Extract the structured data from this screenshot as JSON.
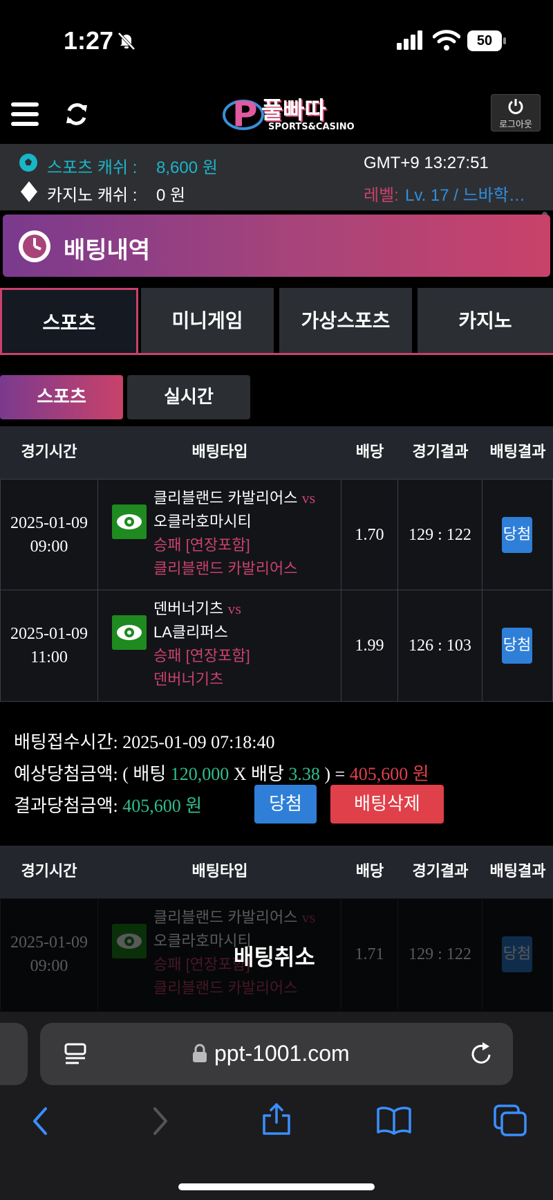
{
  "status": {
    "time": "1:27",
    "battery": "50"
  },
  "header": {
    "logo_text": "풀빠따",
    "logo_sub": "SPORTS&CASINO",
    "logout_label": "로그아웃"
  },
  "info": {
    "sports_cash_label": "스포츠 캐쉬 :",
    "sports_cash_value": "8,600 원",
    "casino_cash_label": "카지노 캐쉬 :",
    "casino_cash_value": "0 원",
    "clock": "GMT+9 13:27:51",
    "level_label": "레벨:",
    "level_value": "Lv. 17 / 느바학…"
  },
  "banner": {
    "title": "배팅내역"
  },
  "tabs": [
    "스포츠",
    "미니게임",
    "가상스포츠",
    "카지노"
  ],
  "subtabs": [
    "스포츠",
    "실시간"
  ],
  "table_headers": [
    "경기시간",
    "배팅타입",
    "배당",
    "경기결과",
    "배팅결과"
  ],
  "bet1": {
    "rows": [
      {
        "date": "2025-01-09",
        "time": "09:00",
        "home": "클리블랜드 카발리어스",
        "vs": "vs",
        "away": "오클라호마시티",
        "market": "승패 [연장포함]",
        "pick": "클리블랜드 카발리어스",
        "odds": "1.70",
        "score": "129 : 122",
        "result": "당첨"
      },
      {
        "date": "2025-01-09",
        "time": "11:00",
        "home": "덴버너기츠",
        "vs": "vs",
        "away": "LA클리퍼스",
        "market": "승패 [연장포함]",
        "pick": "덴버너기츠",
        "odds": "1.99",
        "score": "126 : 103",
        "result": "당첨"
      }
    ],
    "summary": {
      "received_label": "배팅접수시간:",
      "received_value": "2025-01-09 07:18:40",
      "expected_label": "예상당첨금액: ( 배팅",
      "stake": "120,000",
      "x": "X 배당",
      "total_odds": "3.38",
      "eq": ") =",
      "expected_value": "405,600 원",
      "result_label": "결과당첨금액:",
      "result_value": "405,600 원",
      "win_button": "당첨",
      "delete_button": "배팅삭제"
    }
  },
  "bet2": {
    "rows": [
      {
        "date": "2025-01-09",
        "time": "09:00",
        "home": "클리블랜드 카발리어스",
        "vs": "vs",
        "away": "오클라호마시티",
        "market": "승패 [연장포함]",
        "pick": "클리블랜드 카발리어스",
        "odds": "1.71",
        "score": "129 : 122",
        "result": "당첨"
      }
    ],
    "cancel_label": "배팅취소"
  },
  "browser": {
    "url": "ppt-1001.com"
  },
  "colors": {
    "accent": "#c9426a",
    "cyan": "#19b6c8",
    "blue": "#2f7fd8",
    "green": "#2fbf8f",
    "red": "#e0404a"
  }
}
